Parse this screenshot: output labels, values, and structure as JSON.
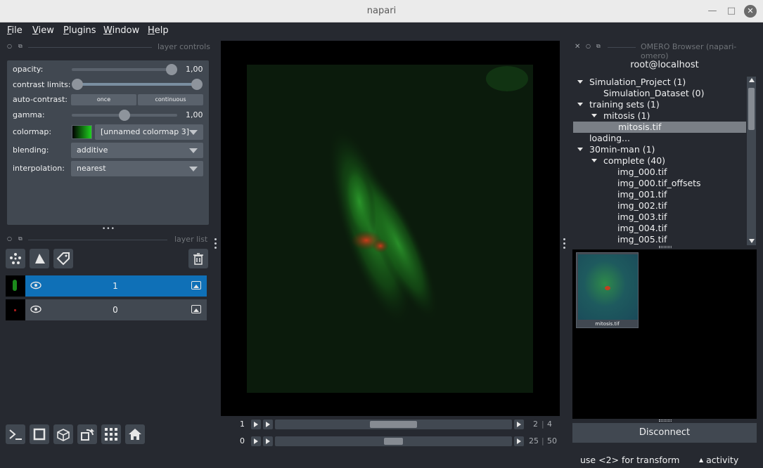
{
  "window": {
    "title": "napari"
  },
  "menu": [
    {
      "underline": "F",
      "rest": "ile"
    },
    {
      "underline": "V",
      "rest": "iew"
    },
    {
      "underline": "P",
      "rest": "lugins"
    },
    {
      "underline": "W",
      "rest": "indow"
    },
    {
      "underline": "H",
      "rest": "elp"
    }
  ],
  "layer_controls": {
    "dock_title": "layer controls",
    "opacity": {
      "label": "opacity:",
      "value": "1,00",
      "level": 1.0
    },
    "contrast_limits": {
      "label": "contrast limits:",
      "low": 0.0,
      "high": 1.0
    },
    "auto_contrast": {
      "label": "auto-contrast:",
      "once": "once",
      "continuous": "continuous"
    },
    "gamma": {
      "label": "gamma:",
      "value": "1,00",
      "level": 0.5
    },
    "colormap": {
      "label": "colormap:",
      "value": "[unnamed colormap 3]"
    },
    "blending": {
      "label": "blending:",
      "value": "additive"
    },
    "interpolation": {
      "label": "interpolation:",
      "value": "nearest"
    }
  },
  "layer_list": {
    "dock_title": "layer list",
    "layers": [
      {
        "name": "1",
        "selected": true,
        "thumb_color": "#2bbf2b"
      },
      {
        "name": "0",
        "selected": false,
        "thumb_color": "#c02020"
      }
    ]
  },
  "dims": [
    {
      "current": "1",
      "position": 0.5,
      "step": "2",
      "total": "4"
    },
    {
      "current": "0",
      "position": 0.5,
      "step": "25",
      "total": "50"
    }
  ],
  "omero": {
    "dock_title": "OMERO Browser (napari-omero)",
    "user": "root@localhost",
    "tree": [
      {
        "label": "Simulation_Project (1)",
        "depth": 0,
        "expanded": true
      },
      {
        "label": "Simulation_Dataset (0)",
        "depth": 1,
        "expanded": false
      },
      {
        "label": "training sets (1)",
        "depth": 0,
        "expanded": true
      },
      {
        "label": "mitosis (1)",
        "depth": 1,
        "expanded": true
      },
      {
        "label": "mitosis.tif",
        "depth": 2,
        "expanded": false,
        "selected": true
      },
      {
        "label": "loading...",
        "depth": 0,
        "expanded": false
      },
      {
        "label": "30min-man (1)",
        "depth": 0,
        "expanded": true
      },
      {
        "label": "complete (40)",
        "depth": 1,
        "expanded": true
      },
      {
        "label": "img_000.tif",
        "depth": 2,
        "expanded": false
      },
      {
        "label": "img_000.tif_offsets",
        "depth": 2,
        "expanded": false
      },
      {
        "label": "img_001.tif",
        "depth": 2,
        "expanded": false
      },
      {
        "label": "img_002.tif",
        "depth": 2,
        "expanded": false
      },
      {
        "label": "img_003.tif",
        "depth": 2,
        "expanded": false
      },
      {
        "label": "img_004.tif",
        "depth": 2,
        "expanded": false
      },
      {
        "label": "img_005.tif",
        "depth": 2,
        "expanded": false
      }
    ],
    "thumbnail_caption": "mitosis.tif",
    "disconnect_label": "Disconnect"
  },
  "status": {
    "message": "use <2> for transform",
    "activity": "activity"
  },
  "colors": {
    "background": "#262930",
    "panel": "#414851",
    "selection": "#0f70b7",
    "tree_selection": "#7a7f86"
  }
}
